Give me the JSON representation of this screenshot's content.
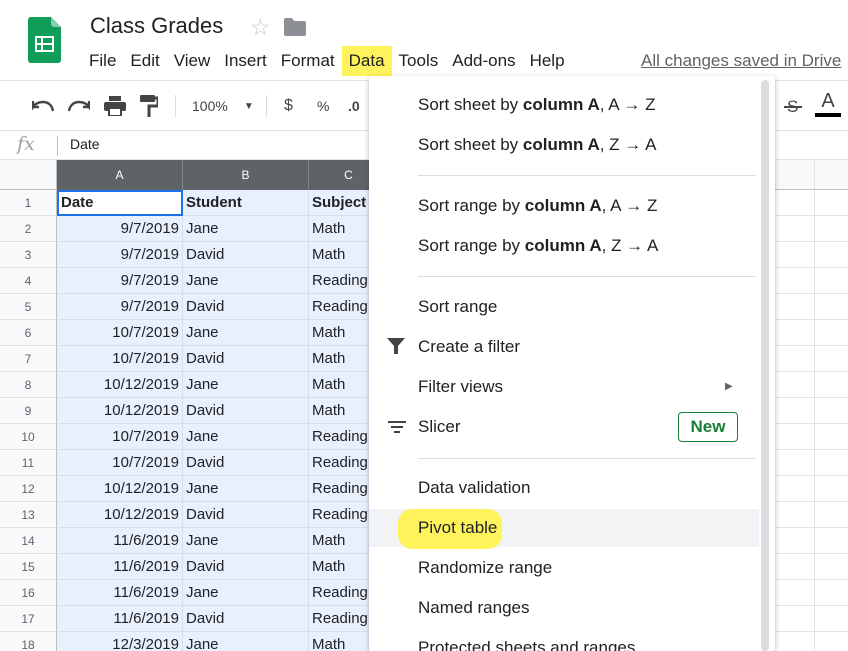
{
  "app": {
    "title": "Class Grades",
    "saved_status": "All changes saved in Drive",
    "menu": [
      "File",
      "Edit",
      "View",
      "Insert",
      "Format",
      "Data",
      "Tools",
      "Add-ons",
      "Help"
    ],
    "active_menu": "Data"
  },
  "toolbar": {
    "zoom": "100%",
    "currency": "$",
    "percent": "%",
    "decimal": ".0",
    "text_color_label": "A"
  },
  "formula_bar": {
    "fx_label": "fx",
    "value": "Date"
  },
  "grid": {
    "columns": [
      "A",
      "B",
      "C"
    ],
    "header_row": [
      "Date",
      "Student",
      "Subject"
    ],
    "rows": [
      {
        "num": "1",
        "cells": [
          "Date",
          "Student",
          "Subject"
        ]
      },
      {
        "num": "2",
        "cells": [
          "9/7/2019",
          "Jane",
          "Math"
        ]
      },
      {
        "num": "3",
        "cells": [
          "9/7/2019",
          "David",
          "Math"
        ]
      },
      {
        "num": "4",
        "cells": [
          "9/7/2019",
          "Jane",
          "Reading"
        ]
      },
      {
        "num": "5",
        "cells": [
          "9/7/2019",
          "David",
          "Reading"
        ]
      },
      {
        "num": "6",
        "cells": [
          "10/7/2019",
          "Jane",
          "Math"
        ]
      },
      {
        "num": "7",
        "cells": [
          "10/7/2019",
          "David",
          "Math"
        ]
      },
      {
        "num": "8",
        "cells": [
          "10/12/2019",
          "Jane",
          "Math"
        ]
      },
      {
        "num": "9",
        "cells": [
          "10/12/2019",
          "David",
          "Math"
        ]
      },
      {
        "num": "10",
        "cells": [
          "10/7/2019",
          "Jane",
          "Reading"
        ]
      },
      {
        "num": "11",
        "cells": [
          "10/7/2019",
          "David",
          "Reading"
        ]
      },
      {
        "num": "12",
        "cells": [
          "10/12/2019",
          "Jane",
          "Reading"
        ]
      },
      {
        "num": "13",
        "cells": [
          "10/12/2019",
          "David",
          "Reading"
        ]
      },
      {
        "num": "14",
        "cells": [
          "11/6/2019",
          "Jane",
          "Math"
        ]
      },
      {
        "num": "15",
        "cells": [
          "11/6/2019",
          "David",
          "Math"
        ]
      },
      {
        "num": "16",
        "cells": [
          "11/6/2019",
          "Jane",
          "Reading"
        ]
      },
      {
        "num": "17",
        "cells": [
          "11/6/2019",
          "David",
          "Reading"
        ]
      },
      {
        "num": "18",
        "cells": [
          "12/3/2019",
          "Jane",
          "Math"
        ]
      }
    ]
  },
  "data_menu": {
    "sort_sheet_az": {
      "pre": "Sort sheet by ",
      "bold": "column A",
      "post": ", A → Z"
    },
    "sort_sheet_za": {
      "pre": "Sort sheet by ",
      "bold": "column A",
      "post": ", Z → A"
    },
    "sort_range_az": {
      "pre": "Sort range by ",
      "bold": "column A",
      "post": ", A → Z"
    },
    "sort_range_za": {
      "pre": "Sort range by ",
      "bold": "column A",
      "post": ", Z → A"
    },
    "sort_range": "Sort range",
    "create_filter": "Create a filter",
    "filter_views": "Filter views",
    "slicer": "Slicer",
    "new_badge": "New",
    "data_validation": "Data validation",
    "pivot_table": "Pivot table",
    "randomize_range": "Randomize range",
    "named_ranges": "Named ranges",
    "protected_ranges": "Protected sheets and ranges"
  },
  "colors": {
    "selection_fill": "#e8f0fe",
    "active_border": "#1a73e8",
    "highlighter": "#fff35c",
    "sheets_green": "#0f9d58"
  }
}
